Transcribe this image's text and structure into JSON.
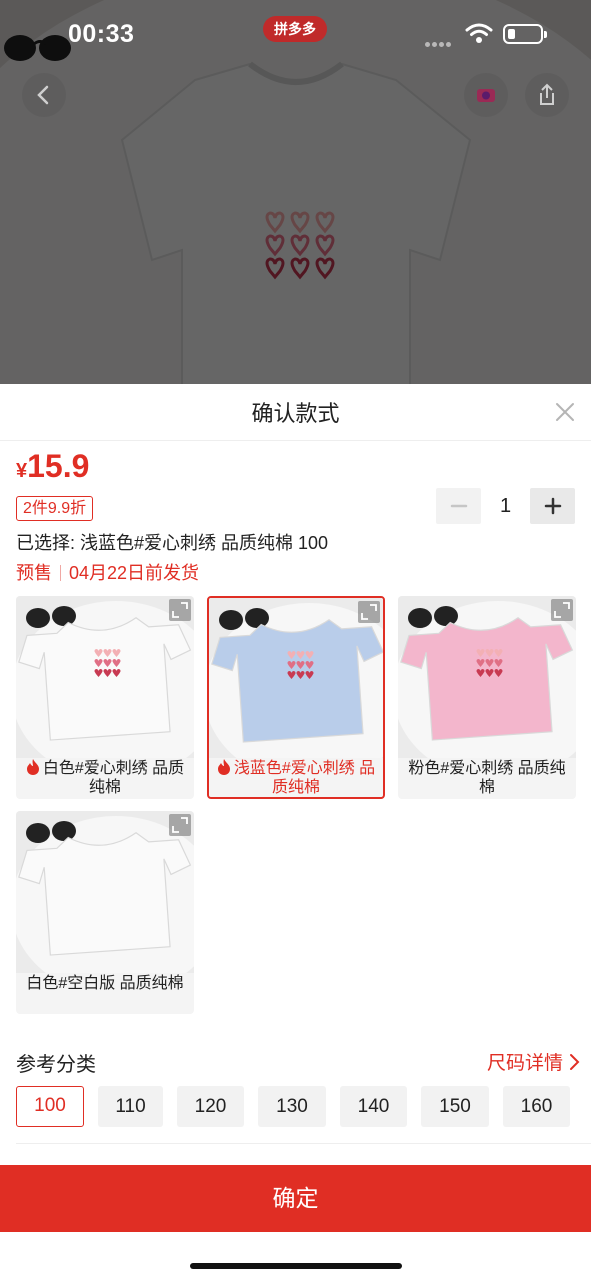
{
  "status_bar": {
    "time": "00:33",
    "app_logo": "拼多多"
  },
  "sheet": {
    "title": "确认款式",
    "currency": "¥",
    "price": "15.9",
    "discount_tag": "2件9.9折",
    "quantity": "1",
    "selected_text": "已选择: 浅蓝色#爱心刺绣 品质纯棉 100",
    "presale_label": "预售",
    "ship_text": "04月22日前发货"
  },
  "styles": [
    {
      "label": "白色#爱心刺绣 品质纯棉",
      "hot": true,
      "selected": false,
      "shirt_color": "#fafafa"
    },
    {
      "label": "浅蓝色#爱心刺绣 品质纯棉",
      "hot": true,
      "selected": true,
      "shirt_color": "#b9cdea"
    },
    {
      "label": "粉色#爱心刺绣 品质纯棉",
      "hot": false,
      "selected": false,
      "shirt_color": "#f3b6cc"
    },
    {
      "label": "白色#空白版 品质纯棉",
      "hot": false,
      "selected": false,
      "shirt_color": "#fafafa"
    }
  ],
  "size": {
    "title": "参考分类",
    "guide_label": "尺码详情",
    "options": [
      "100",
      "110",
      "120",
      "130",
      "140",
      "150",
      "160"
    ],
    "selected": "100"
  },
  "confirm_label": "确定",
  "colors": {
    "accent": "#e02e24",
    "chip_bg": "#f2f2f2"
  },
  "icons": [
    "back-icon",
    "favorite-icon",
    "share-icon",
    "close-icon",
    "minus-icon",
    "plus-icon",
    "zoom-icon",
    "flame-icon",
    "chevron-right-icon",
    "wifi-icon",
    "battery-icon"
  ]
}
